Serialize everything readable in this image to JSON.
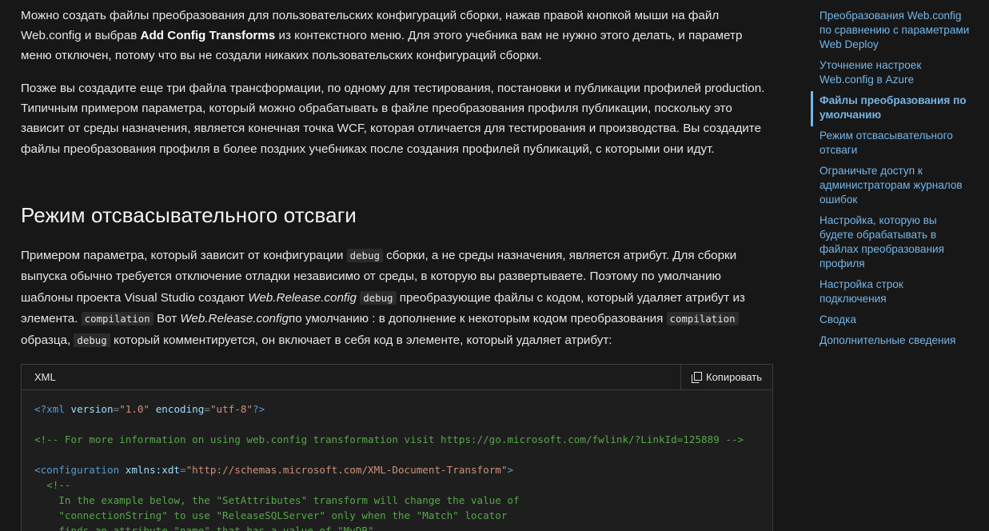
{
  "article": {
    "p1": {
      "t1": "Можно создать файлы преобразования для пользовательских конфигураций сборки, нажав правой кнопкой мыши на файл Web.config и выбрав ",
      "bold": "Add Config Transforms",
      "t2": " из контекстного меню. Для этого учебника вам не нужно этого делать, и параметр меню отключен, потому что вы не создали никаких пользовательских конфигураций сборки."
    },
    "p2": "Позже вы создадите еще три файла трансформации, по одному для тестирования, постановки и публикации профилей production. Типичным примером параметра, который можно обрабатывать в файле преобразования профиля публикации, поскольку это зависит от среды назначения, является конечная точка WCF, которая отличается для тестирования и производства. Вы создадите файлы преобразования профиля в более поздних учебниках после создания профилей публикаций, с которыми они идут.",
    "heading": "Режим отсвасывательного отсваги",
    "p3": {
      "t1": "Примером параметра, который зависит от конфигурации ",
      "code1": "debug",
      "t2": " сборки, а не среды назначения, является атрибут. Для сборки выпуска обычно требуется отключение отладки независимо от среды, в которую вы развертываете. Поэтому по умолчанию шаблоны проекта Visual Studio создают ",
      "em1": "Web.Release.config",
      "t3": " ",
      "code2": "debug",
      "t4": " преобразующие файлы с кодом, который удаляет атрибут из элемента. ",
      "code3": "compilation",
      "t5": " Вот ",
      "em2": "Web.Release.config",
      "t6": "по умолчанию : в дополнение к некоторым кодом преобразования ",
      "code4": "compilation",
      "t7": " образца, ",
      "code5": "debug",
      "t8": " который комментируется, он включает в себя код в элементе, который удаляет атрибут:"
    },
    "codeblock": {
      "language": "XML",
      "copy_label": "Копировать",
      "line1": {
        "open": "<?",
        "name": "xml",
        "a1": " version",
        "eq1": "=",
        "v1": "\"1.0\"",
        "a2": " encoding",
        "eq2": "=",
        "v2": "\"utf-8\"",
        "close": "?>"
      },
      "line2": "<!-- For more information on using web.config transformation visit https://go.microsoft.com/fwlink/?LinkId=125889 -->",
      "line3": {
        "open": "<",
        "name": "configuration",
        "attr": " xmlns:xdt",
        "eq": "=",
        "val": "\"http://schemas.microsoft.com/XML-Document-Transform\"",
        "close": ">"
      },
      "line4": "  <!--",
      "line5": "    In the example below, the \"SetAttributes\" transform will change the value of",
      "line6": "    \"connectionString\" to use \"ReleaseSQLServer\" only when the \"Match\" locator",
      "line7": "    finds an attribute \"name\" that has a value of \"MyDB\"."
    }
  },
  "toc": [
    {
      "label": "Преобразования Web.config по сравнению с параметрами Web Deploy",
      "active": false
    },
    {
      "label": "Уточнение настроек Web.config в Azure",
      "active": false
    },
    {
      "label": "Файлы преобразования по умолчанию",
      "active": true
    },
    {
      "label": "Режим отсвасывательного отсваги",
      "active": false
    },
    {
      "label": "Ограничьте доступ к администраторам журналов ошибок",
      "active": false
    },
    {
      "label": "Настройка, которую вы будете обрабатывать в файлах преобразования профиля",
      "active": false
    },
    {
      "label": "Настройка строк подключения",
      "active": false
    },
    {
      "label": "Сводка",
      "active": false
    },
    {
      "label": "Дополнительные сведения",
      "active": false
    }
  ],
  "colors": {
    "link": "#75b6e7",
    "background": "#171717"
  },
  "icons": {
    "copy": "copy-icon"
  }
}
